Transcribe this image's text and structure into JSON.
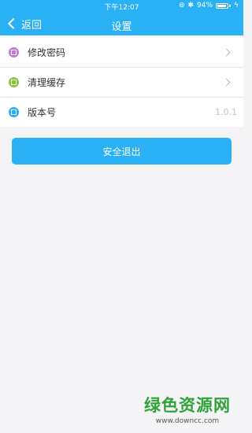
{
  "status_bar": {
    "time": "下午12:07",
    "battery": "94%",
    "battery_level": 0.94,
    "icons": [
      "orientation-lock-icon",
      "bluetooth-icon",
      "battery-icon",
      "charging-icon"
    ]
  },
  "nav": {
    "back_label": "返回",
    "title": "设置"
  },
  "settings": {
    "items": [
      {
        "label": "修改密码",
        "icon": "lock-icon",
        "icon_color": "#c278d6",
        "chevron": true
      },
      {
        "label": "清理缓存",
        "icon": "clean-icon",
        "icon_color": "#8cc63f",
        "chevron": true
      },
      {
        "label": "版本号",
        "icon": "version-icon",
        "icon_color": "#2ab0f5",
        "value": "1.0.1"
      }
    ]
  },
  "logout_label": "安全退出",
  "watermark": {
    "title": "绿色资源网",
    "url": "www.downcc.com"
  },
  "colors": {
    "accent": "#2ab0f5",
    "background": "#f4f4f6",
    "watermark_green": "#2fa33a"
  }
}
